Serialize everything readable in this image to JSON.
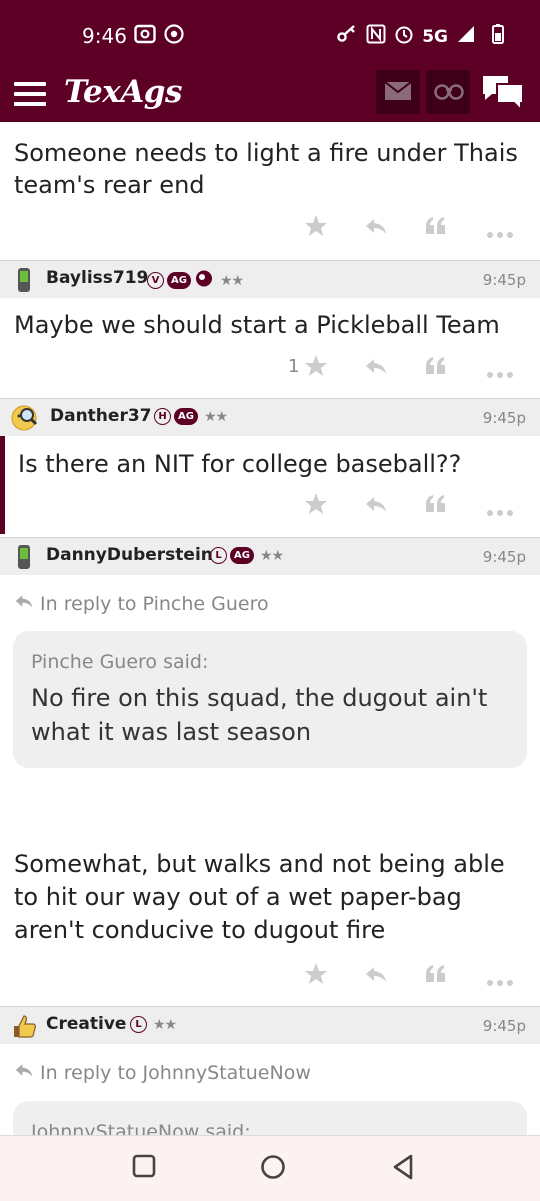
{
  "status_bar": {
    "time": "9:46",
    "network": "5G",
    "icons": [
      "screen-record-icon",
      "chrome-icon",
      "key-icon",
      "nfc-icon",
      "alarm-icon",
      "signal-icon",
      "battery-icon"
    ]
  },
  "app": {
    "logo": "TexAgs",
    "brand_color": "#5c0025",
    "header_icons": [
      "menu-icon",
      "mail-icon",
      "binoculars-icon",
      "chat-icon"
    ]
  },
  "posts": [
    {
      "body": "Someone needs to light a fire under Thais team's rear end"
    },
    {
      "username": "Bayliss719",
      "badges": [
        "V",
        "AG"
      ],
      "stars": "★★",
      "time": "9:45p",
      "body": "Maybe we should start a Pickleball Team",
      "like_count": "1"
    },
    {
      "username": "Danther37",
      "badges": [
        "H",
        "AG"
      ],
      "stars": "★★",
      "time": "9:45p",
      "body": "Is there an NIT for college baseball??"
    },
    {
      "username": "DannyDuberstein",
      "badges": [
        "L",
        "AG"
      ],
      "stars": "★★",
      "time": "9:45p",
      "reply_to": "In reply to Pinche Guero",
      "quote_author": "Pinche Guero said:",
      "quote_text": "No fire on this squad, the dugout ain't what it was last season",
      "body": "Somewhat, but walks and not being able to hit our way out of a wet paper-bag aren't conducive to dugout fire"
    },
    {
      "username": "Creative",
      "badges": [
        "L"
      ],
      "stars": "★★",
      "time": "9:45p",
      "reply_to": "In reply to JohnnyStatueNow",
      "quote_author": "JohnnyStatueNow said:"
    }
  ],
  "nav_bar": {
    "icons": [
      "recents-square-icon",
      "home-circle-icon",
      "back-triangle-icon"
    ]
  }
}
